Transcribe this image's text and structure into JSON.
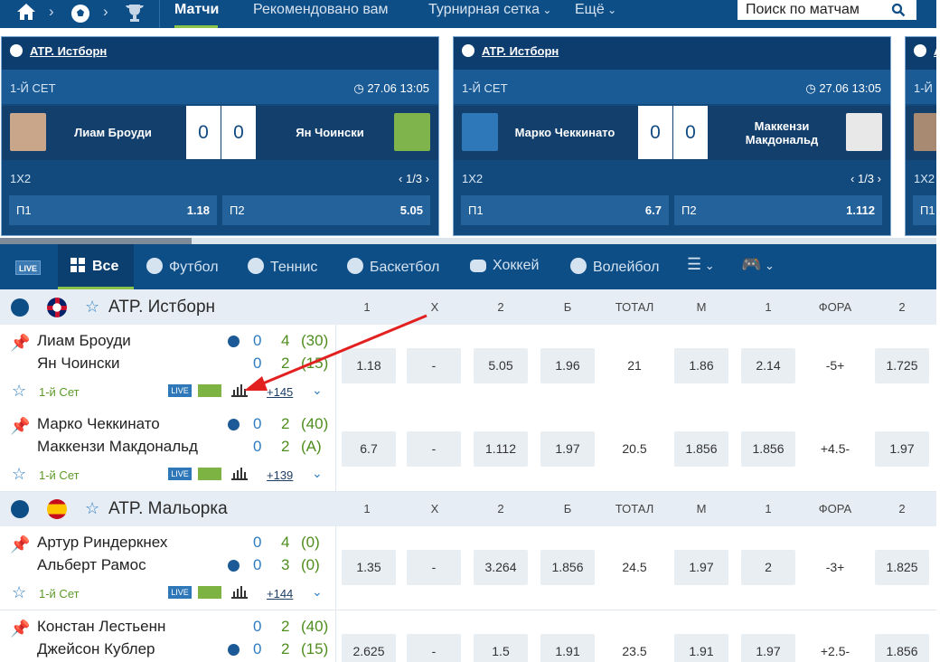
{
  "topnav": {
    "tabs": [
      "Матчи",
      "Рекомендовано вам",
      "Турнирная сетка",
      "Ещё"
    ],
    "search_label": "Поиск по матчам"
  },
  "carousel": {
    "cards": [
      {
        "league": "ATP. Истборн",
        "set": "1-Й СЕТ",
        "time": "27.06 13:05",
        "player1": "Лиам Броуди",
        "player2": "Ян Чоински",
        "score1": "0",
        "score2": "0",
        "market": "1X2",
        "pager": "1/3",
        "odds": [
          {
            "label": "П1",
            "value": "1.18"
          },
          {
            "label": "П2",
            "value": "5.05"
          }
        ]
      },
      {
        "league": "ATP. Истборн",
        "set": "1-Й СЕТ",
        "time": "27.06 13:05",
        "player1": "Марко Чеккинато",
        "player2": "Маккензи Макдональд",
        "score1": "0",
        "score2": "0",
        "market": "1X2",
        "pager": "1/3",
        "odds": [
          {
            "label": "П1",
            "value": "6.7"
          },
          {
            "label": "П2",
            "value": "1.112"
          }
        ]
      },
      {
        "league": "A",
        "set": "1-Й",
        "market": "1X2",
        "odds": [
          {
            "label": "П1",
            "value": ""
          }
        ]
      }
    ]
  },
  "sports": {
    "live": "LIVE",
    "items": [
      "Все",
      "Футбол",
      "Теннис",
      "Баскетбол",
      "Хоккей",
      "Волейбол"
    ]
  },
  "columns": [
    "1",
    "X",
    "2",
    "Б",
    "ТОТАЛ",
    "М",
    "1",
    "ФОРА",
    "2"
  ],
  "leagues": [
    {
      "name": "ATP. Истборн",
      "matches": [
        {
          "p1": "Лиам Броуди",
          "p2": "Ян Чоински",
          "s1": "0",
          "s2": "0",
          "g1": "4",
          "g2": "2",
          "pt1": "(30)",
          "pt2": "(15)",
          "set": "1-й Сет",
          "more": "+145",
          "odds": [
            "1.18",
            "-",
            "5.05",
            "1.96",
            "21",
            "1.86",
            "2.14",
            "-5+",
            "1.725"
          ]
        },
        {
          "p1": "Марко Чеккинато",
          "p2": "Маккензи Макдональд",
          "s1": "0",
          "s2": "0",
          "g1": "2",
          "g2": "2",
          "pt1": "(40)",
          "pt2": "(A)",
          "set": "1-й Сет",
          "more": "+139",
          "odds": [
            "6.7",
            "-",
            "1.112",
            "1.97",
            "20.5",
            "1.856",
            "1.856",
            "+4.5-",
            "1.97"
          ]
        }
      ]
    },
    {
      "name": "ATP. Мальорка",
      "matches": [
        {
          "p1": "Артур Риндеркнех",
          "p2": "Альберт Рамос",
          "s1": "0",
          "s2": "0",
          "g1": "4",
          "g2": "3",
          "pt1": "(0)",
          "pt2": "(0)",
          "set": "1-й Сет",
          "more": "+144",
          "odds": [
            "1.35",
            "-",
            "3.264",
            "1.856",
            "24.5",
            "1.97",
            "2",
            "-3+",
            "1.825"
          ]
        },
        {
          "p1": "Констан Лестьенн",
          "p2": "Джейсон Кублер",
          "s1": "0",
          "s2": "0",
          "g1": "2",
          "g2": "2",
          "pt1": "(40)",
          "pt2": "(15)",
          "odds": [
            "2.625",
            "-",
            "1.5",
            "1.91",
            "23.5",
            "1.91",
            "1.97",
            "+2.5-",
            "1.856"
          ]
        }
      ]
    }
  ],
  "mini_badges": {
    "live": "LIVE"
  },
  "colors": {
    "nav": "#0e4e87",
    "accent_green": "#8bc34a",
    "annotation_arrow": "#e32020"
  }
}
